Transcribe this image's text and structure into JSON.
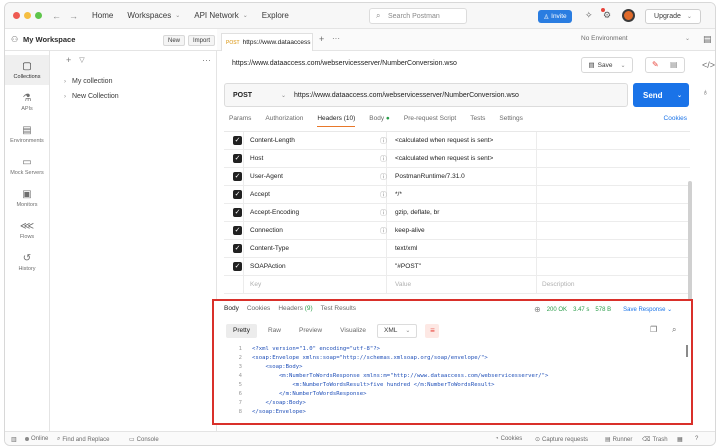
{
  "colors": {
    "send": "#1a73e8",
    "invite": "#2a7de1",
    "highlight": "#d9302a",
    "status_ok": "#2a9d4a",
    "accent": "#e8782a"
  },
  "topbar": {
    "back_icon": "arrow-left-icon",
    "forward_icon": "arrow-right-icon",
    "nav": [
      "Home",
      "Workspaces",
      "API Network",
      "Explore"
    ],
    "search_placeholder": "Search Postman",
    "invite_label": "Invite",
    "upgrade_label": "Upgrade"
  },
  "workspace": {
    "title": "My Workspace",
    "new_label": "New",
    "import_label": "Import"
  },
  "rail": [
    {
      "label": "Collections",
      "icon": "collections-icon"
    },
    {
      "label": "APIs",
      "icon": "apis-icon"
    },
    {
      "label": "Environments",
      "icon": "environments-icon"
    },
    {
      "label": "Mock Servers",
      "icon": "mock-servers-icon"
    },
    {
      "label": "Monitors",
      "icon": "monitors-icon"
    },
    {
      "label": "Flows",
      "icon": "flows-icon"
    },
    {
      "label": "History",
      "icon": "history-icon"
    }
  ],
  "collections": [
    "My collection",
    "New Collection"
  ],
  "tab": {
    "method": "POST",
    "title": "https://www.dataaccess"
  },
  "environment": "No Environment",
  "request": {
    "name": "https://www.dataaccess.com/webservicesserver/NumberConversion.wso",
    "save_label": "Save",
    "method": "POST",
    "url": "https://www.dataaccess.com/webservicesserver/NumberConversion.wso",
    "send_label": "Send"
  },
  "req_tabs": [
    "Params",
    "Authorization",
    "Headers (10)",
    "Body",
    "Pre-request Script",
    "Tests",
    "Settings"
  ],
  "cookies_label": "Cookies",
  "headers": [
    {
      "key": "Content-Length",
      "value": "<calculated when request is sent>",
      "info": true
    },
    {
      "key": "Host",
      "value": "<calculated when request is sent>",
      "info": true
    },
    {
      "key": "User-Agent",
      "value": "PostmanRuntime/7.31.0",
      "info": true
    },
    {
      "key": "Accept",
      "value": "*/*",
      "info": true
    },
    {
      "key": "Accept-Encoding",
      "value": "gzip, deflate, br",
      "info": true
    },
    {
      "key": "Connection",
      "value": "keep-alive",
      "info": true
    },
    {
      "key": "Content-Type",
      "value": "text/xml",
      "info": false
    },
    {
      "key": "SOAPAction",
      "value": "\"#POST\"",
      "info": false
    }
  ],
  "header_placeholder": {
    "key": "Key",
    "value": "Value",
    "description": "Description"
  },
  "response": {
    "tabs": [
      "Body",
      "Cookies",
      "Headers",
      "Test Results"
    ],
    "headers_count": "(9)",
    "status": "200 OK",
    "time": "3.47 s",
    "size": "578 B",
    "save_label": "Save Response",
    "views": [
      "Pretty",
      "Raw",
      "Preview",
      "Visualize"
    ],
    "format": "XML"
  },
  "code_lines": [
    "<?xml version=\"1.0\" encoding=\"utf-8\"?>",
    "<soap:Envelope xmlns:soap=\"http://schemas.xmlsoap.org/soap/envelope/\">",
    "    <soap:Body>",
    "        <m:NumberToWordsResponse xmlns:m=\"http://www.dataaccess.com/webservicesserver/\">",
    "            <m:NumberToWordsResult>five hundred </m:NumberToWordsResult>",
    "        </m:NumberToWordsResponse>",
    "    </soap:Body>",
    "</soap:Envelope>"
  ],
  "statusbar": [
    "Online",
    "Find and Replace",
    "Console",
    "Cookies",
    "Capture requests",
    "Runner",
    "Trash"
  ]
}
